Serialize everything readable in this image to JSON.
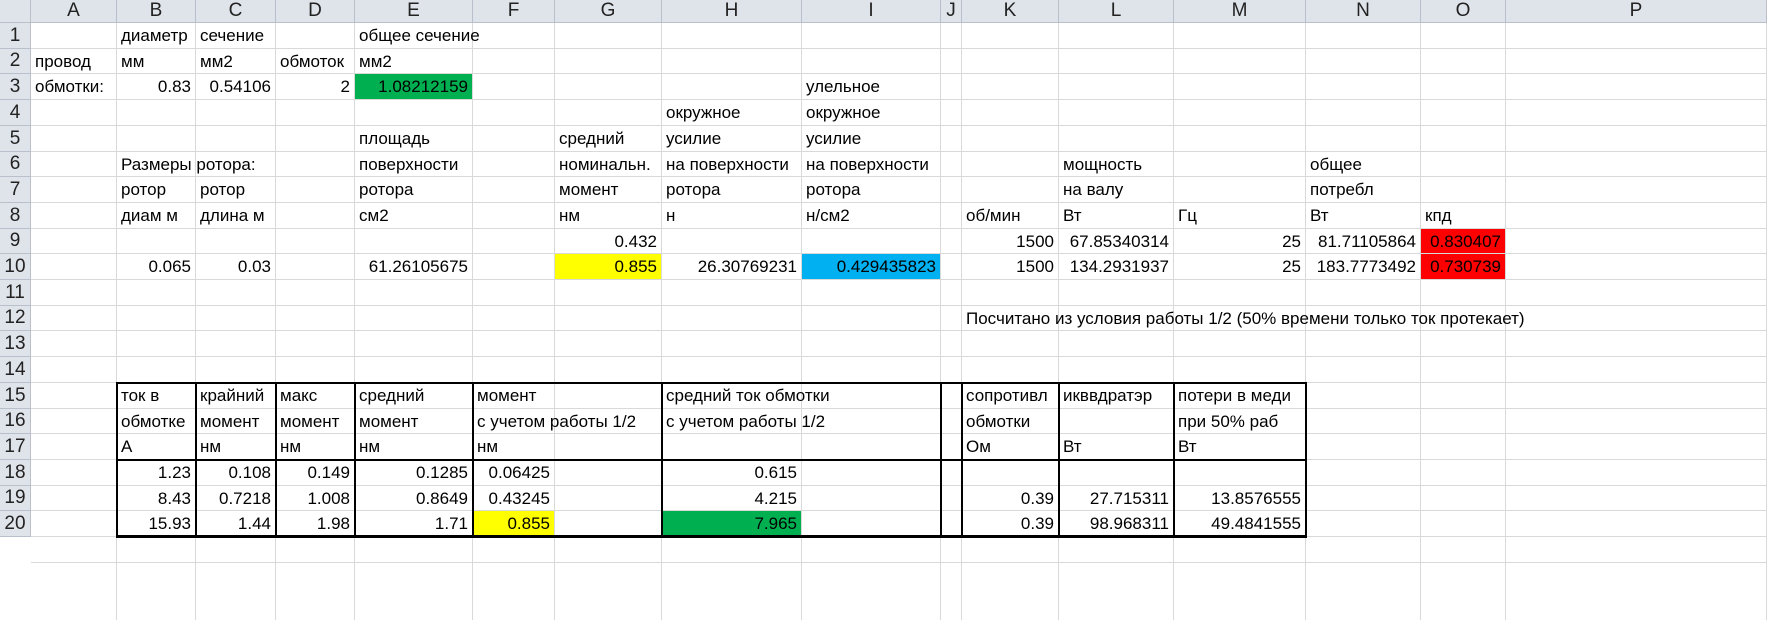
{
  "columns": [
    "A",
    "B",
    "C",
    "D",
    "E",
    "F",
    "G",
    "H",
    "I",
    "J",
    "K",
    "L",
    "M",
    "N",
    "O",
    "P"
  ],
  "rows": [
    "1",
    "2",
    "3",
    "4",
    "5",
    "6",
    "7",
    "8",
    "9",
    "10",
    "11",
    "12",
    "13",
    "14",
    "15",
    "16",
    "17",
    "18",
    "19",
    "20"
  ],
  "colors": {
    "green": "#00b050",
    "yellow": "#ffff00",
    "blue": "#00b0f0",
    "red": "#ff0000"
  },
  "cells": [
    {
      "ref": "B1",
      "text": "диаметр",
      "align": "left"
    },
    {
      "ref": "C1",
      "text": "сечение",
      "align": "left"
    },
    {
      "ref": "E1",
      "text": "общее сечение",
      "align": "left"
    },
    {
      "ref": "A2",
      "text": "провод",
      "align": "left"
    },
    {
      "ref": "B2",
      "text": "мм",
      "align": "left"
    },
    {
      "ref": "C2",
      "text": "мм2",
      "align": "left"
    },
    {
      "ref": "D2",
      "text": "обмоток",
      "align": "left"
    },
    {
      "ref": "E2",
      "text": "мм2",
      "align": "left"
    },
    {
      "ref": "A3",
      "text": "обмотки:",
      "align": "left"
    },
    {
      "ref": "B3",
      "text": "0.83",
      "align": "right"
    },
    {
      "ref": "C3",
      "text": "0.54106",
      "align": "right"
    },
    {
      "ref": "D3",
      "text": "2",
      "align": "right"
    },
    {
      "ref": "E3",
      "text": "1.08212159",
      "align": "right",
      "fill": "green"
    },
    {
      "ref": "I3",
      "text": "улельное",
      "align": "left"
    },
    {
      "ref": "H4",
      "text": "окружное",
      "align": "left"
    },
    {
      "ref": "I4",
      "text": "окружное",
      "align": "left"
    },
    {
      "ref": "E5",
      "text": "площадь",
      "align": "left"
    },
    {
      "ref": "G5",
      "text": "средний",
      "align": "left"
    },
    {
      "ref": "H5",
      "text": "усилие",
      "align": "left"
    },
    {
      "ref": "I5",
      "text": "усилие",
      "align": "left"
    },
    {
      "ref": "B6",
      "text": "Размеры ротора:",
      "align": "left"
    },
    {
      "ref": "E6",
      "text": "поверхности",
      "align": "left"
    },
    {
      "ref": "G6",
      "text": "номинальн.",
      "align": "left"
    },
    {
      "ref": "H6",
      "text": "на поверхности",
      "align": "left"
    },
    {
      "ref": "I6",
      "text": "на поверхности",
      "align": "left"
    },
    {
      "ref": "L6",
      "text": "мощность",
      "align": "left"
    },
    {
      "ref": "N6",
      "text": "общее",
      "align": "left"
    },
    {
      "ref": "B7",
      "text": "ротор",
      "align": "left"
    },
    {
      "ref": "C7",
      "text": "ротор",
      "align": "left"
    },
    {
      "ref": "E7",
      "text": "ротора",
      "align": "left"
    },
    {
      "ref": "G7",
      "text": "момент",
      "align": "left"
    },
    {
      "ref": "H7",
      "text": "ротора",
      "align": "left"
    },
    {
      "ref": "I7",
      "text": "ротора",
      "align": "left"
    },
    {
      "ref": "L7",
      "text": "на валу",
      "align": "left"
    },
    {
      "ref": "N7",
      "text": "потребл",
      "align": "left"
    },
    {
      "ref": "B8",
      "text": "диам м",
      "align": "left"
    },
    {
      "ref": "C8",
      "text": "длина м",
      "align": "left"
    },
    {
      "ref": "E8",
      "text": "см2",
      "align": "left"
    },
    {
      "ref": "G8",
      "text": "нм",
      "align": "left"
    },
    {
      "ref": "H8",
      "text": "н",
      "align": "left"
    },
    {
      "ref": "I8",
      "text": "н/см2",
      "align": "left"
    },
    {
      "ref": "K8",
      "text": "об/мин",
      "align": "left"
    },
    {
      "ref": "L8",
      "text": "Вт",
      "align": "left"
    },
    {
      "ref": "M8",
      "text": "Гц",
      "align": "left"
    },
    {
      "ref": "N8",
      "text": "Вт",
      "align": "left"
    },
    {
      "ref": "O8",
      "text": "кпд",
      "align": "left"
    },
    {
      "ref": "G9",
      "text": "0.432",
      "align": "right"
    },
    {
      "ref": "K9",
      "text": "1500",
      "align": "right"
    },
    {
      "ref": "L9",
      "text": "67.85340314",
      "align": "right"
    },
    {
      "ref": "M9",
      "text": "25",
      "align": "right"
    },
    {
      "ref": "N9",
      "text": "81.71105864",
      "align": "right"
    },
    {
      "ref": "O9",
      "text": "0.830407",
      "align": "right",
      "fill": "red"
    },
    {
      "ref": "B10",
      "text": "0.065",
      "align": "right"
    },
    {
      "ref": "C10",
      "text": "0.03",
      "align": "right"
    },
    {
      "ref": "E10",
      "text": "61.26105675",
      "align": "right"
    },
    {
      "ref": "G10",
      "text": "0.855",
      "align": "right",
      "fill": "yellow"
    },
    {
      "ref": "H10",
      "text": "26.30769231",
      "align": "right"
    },
    {
      "ref": "I10",
      "text": "0.429435823",
      "align": "right",
      "fill": "blue"
    },
    {
      "ref": "K10",
      "text": "1500",
      "align": "right"
    },
    {
      "ref": "L10",
      "text": "134.2931937",
      "align": "right"
    },
    {
      "ref": "M10",
      "text": "25",
      "align": "right"
    },
    {
      "ref": "N10",
      "text": "183.7773492",
      "align": "right"
    },
    {
      "ref": "O10",
      "text": "0.730739",
      "align": "right",
      "fill": "red"
    },
    {
      "ref": "K12",
      "text": "Посчитано из условия работы 1/2 (50% времени только ток протекает)",
      "align": "left"
    },
    {
      "ref": "B15",
      "text": "ток в",
      "align": "left"
    },
    {
      "ref": "C15",
      "text": "крайний",
      "align": "left"
    },
    {
      "ref": "D15",
      "text": "макс",
      "align": "left"
    },
    {
      "ref": "E15",
      "text": "средний",
      "align": "left"
    },
    {
      "ref": "F15",
      "text": "момент",
      "align": "left"
    },
    {
      "ref": "H15",
      "text": "средний ток обмотки",
      "align": "left"
    },
    {
      "ref": "K15",
      "text": "сопротивл",
      "align": "left"
    },
    {
      "ref": "L15",
      "text": "икввдратэр",
      "align": "left"
    },
    {
      "ref": "M15",
      "text": "потери в меди",
      "align": "left"
    },
    {
      "ref": "B16",
      "text": "обмотке",
      "align": "left"
    },
    {
      "ref": "C16",
      "text": "момент",
      "align": "left"
    },
    {
      "ref": "D16",
      "text": "момент",
      "align": "left"
    },
    {
      "ref": "E16",
      "text": "момент",
      "align": "left"
    },
    {
      "ref": "F16",
      "text": "с учетом работы 1/2",
      "align": "left"
    },
    {
      "ref": "H16",
      "text": "с учетом работы 1/2",
      "align": "left"
    },
    {
      "ref": "K16",
      "text": "обмотки",
      "align": "left"
    },
    {
      "ref": "M16",
      "text": "при 50% раб",
      "align": "left"
    },
    {
      "ref": "B17",
      "text": "А",
      "align": "left"
    },
    {
      "ref": "C17",
      "text": "нм",
      "align": "left"
    },
    {
      "ref": "D17",
      "text": "нм",
      "align": "left"
    },
    {
      "ref": "E17",
      "text": "нм",
      "align": "left"
    },
    {
      "ref": "F17",
      "text": "нм",
      "align": "left"
    },
    {
      "ref": "K17",
      "text": "Ом",
      "align": "left"
    },
    {
      "ref": "L17",
      "text": "Вт",
      "align": "left"
    },
    {
      "ref": "M17",
      "text": "Вт",
      "align": "left"
    },
    {
      "ref": "B18",
      "text": "1.23",
      "align": "right"
    },
    {
      "ref": "C18",
      "text": "0.108",
      "align": "right"
    },
    {
      "ref": "D18",
      "text": "0.149",
      "align": "right"
    },
    {
      "ref": "E18",
      "text": "0.1285",
      "align": "right"
    },
    {
      "ref": "F18",
      "text": "0.06425",
      "align": "right"
    },
    {
      "ref": "H18",
      "text": "0.615",
      "align": "right"
    },
    {
      "ref": "B19",
      "text": "8.43",
      "align": "right"
    },
    {
      "ref": "C19",
      "text": "0.7218",
      "align": "right"
    },
    {
      "ref": "D19",
      "text": "1.008",
      "align": "right"
    },
    {
      "ref": "E19",
      "text": "0.8649",
      "align": "right"
    },
    {
      "ref": "F19",
      "text": "0.43245",
      "align": "right"
    },
    {
      "ref": "H19",
      "text": "4.215",
      "align": "right"
    },
    {
      "ref": "K19",
      "text": "0.39",
      "align": "right"
    },
    {
      "ref": "L19",
      "text": "27.715311",
      "align": "right"
    },
    {
      "ref": "M19",
      "text": "13.8576555",
      "align": "right"
    },
    {
      "ref": "B20",
      "text": "15.93",
      "align": "right"
    },
    {
      "ref": "C20",
      "text": "1.44",
      "align": "right"
    },
    {
      "ref": "D20",
      "text": "1.98",
      "align": "right"
    },
    {
      "ref": "E20",
      "text": "1.71",
      "align": "right"
    },
    {
      "ref": "F20",
      "text": "0.855",
      "align": "right",
      "fill": "yellow"
    },
    {
      "ref": "H20",
      "text": "7.965",
      "align": "right",
      "fill": "green"
    },
    {
      "ref": "K20",
      "text": "0.39",
      "align": "right"
    },
    {
      "ref": "L20",
      "text": "98.968311",
      "align": "right"
    },
    {
      "ref": "M20",
      "text": "49.4841555",
      "align": "right"
    }
  ]
}
